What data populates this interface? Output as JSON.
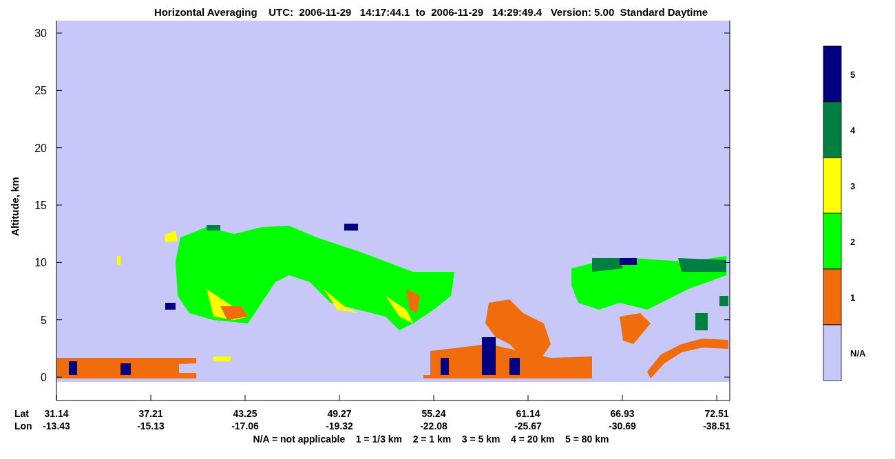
{
  "title": "Horizontal Averaging    UTC:  2006-11-29   14:17:44.1  to  2006-11-29   14:29:49.4   Version: 5.00  Standard Daytime",
  "y_axis": {
    "label": "Altitude, km",
    "ticks": [
      "30",
      "25",
      "20",
      "15",
      "10",
      "5",
      "0"
    ]
  },
  "x_axis": {
    "row_labels": [
      "Lat",
      "Lon"
    ],
    "ticks": [
      {
        "lat": "31.14",
        "lon": "-13.43"
      },
      {
        "lat": "37.21",
        "lon": "-15.13"
      },
      {
        "lat": "43.25",
        "lon": "-17.06"
      },
      {
        "lat": "49.27",
        "lon": "-19.32"
      },
      {
        "lat": "55.24",
        "lon": "-22.08"
      },
      {
        "lat": "61.14",
        "lon": "-25.67"
      },
      {
        "lat": "66.93",
        "lon": "-30.69"
      },
      {
        "lat": "72.51",
        "lon": "-38.51"
      }
    ]
  },
  "footnote": "N/A = not applicable    1 = 1/3 km    2 = 1 km    3 = 5 km    4 = 20 km    5 = 80 km",
  "colorbar": [
    {
      "label": "5",
      "color": "#000080"
    },
    {
      "label": "4",
      "color": "#008040"
    },
    {
      "label": "3",
      "color": "#ffff00"
    },
    {
      "label": "2",
      "color": "#00ff00"
    },
    {
      "label": "1",
      "color": "#f06c0c"
    },
    {
      "label": "N/A",
      "color": "#c8c8f8"
    }
  ]
}
